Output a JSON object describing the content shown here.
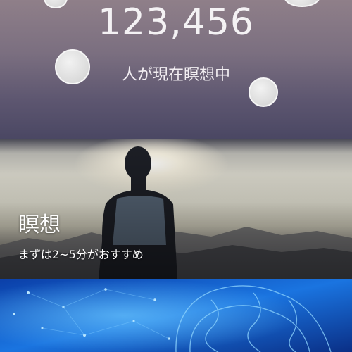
{
  "counter": {
    "value": "123,456",
    "caption": "人が現在瞑想中"
  },
  "meditation_card": {
    "title": "瞑想",
    "subtitle": "まずは2~5分がおすすめ",
    "image": "person-meditating-sunrise-photo"
  },
  "brain_card": {
    "image": "blue-brain-network-illustration"
  },
  "colors": {
    "hero_top": "#8f7f89",
    "hero_bottom": "#4a4763",
    "brain_blue": "#1f6fd6"
  }
}
